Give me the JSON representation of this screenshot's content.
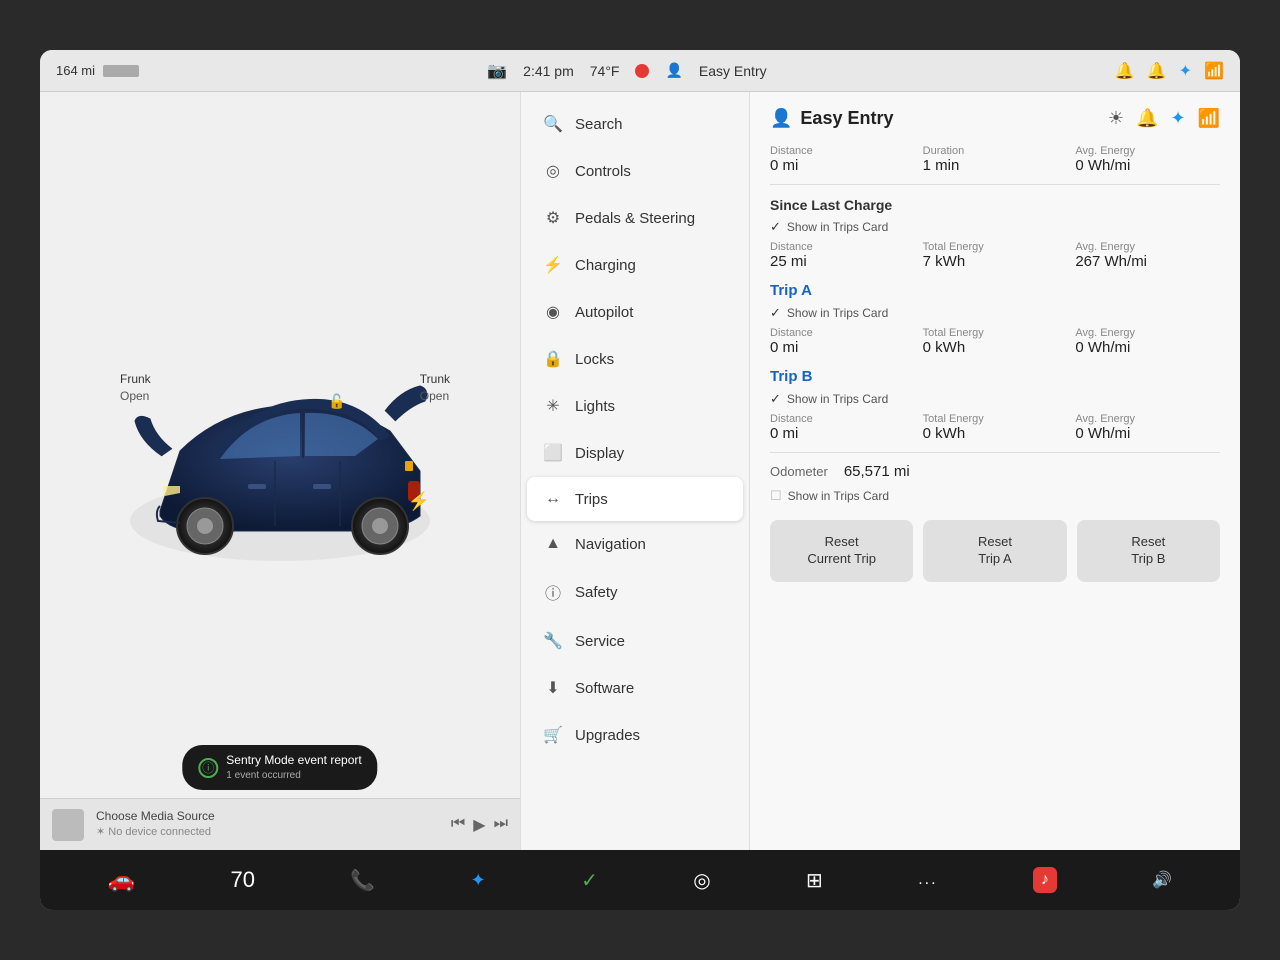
{
  "statusBar": {
    "range": "164 mi",
    "time": "2:41 pm",
    "temp": "74°F",
    "mode": "Easy Entry",
    "userIcon": "👤"
  },
  "carPanel": {
    "frunkLabel": "Frunk",
    "frunkStatus": "Open",
    "trunkLabel": "Trunk",
    "trunkStatus": "Open",
    "sentryBadge": "Sentry Mode event report",
    "sentrySubtext": "1 event occurred"
  },
  "mediaBar": {
    "chooseSource": "Choose Media Source",
    "noDevice": "✶ No device connected"
  },
  "menu": {
    "items": [
      {
        "id": "search",
        "icon": "🔍",
        "label": "Search"
      },
      {
        "id": "controls",
        "icon": "◎",
        "label": "Controls"
      },
      {
        "id": "pedals",
        "icon": "🎚",
        "label": "Pedals & Steering"
      },
      {
        "id": "charging",
        "icon": "⚡",
        "label": "Charging"
      },
      {
        "id": "autopilot",
        "icon": "◉",
        "label": "Autopilot"
      },
      {
        "id": "locks",
        "icon": "🔒",
        "label": "Locks"
      },
      {
        "id": "lights",
        "icon": "✳",
        "label": "Lights"
      },
      {
        "id": "display",
        "icon": "⬜",
        "label": "Display"
      },
      {
        "id": "trips",
        "icon": "↔",
        "label": "Trips",
        "active": true
      },
      {
        "id": "navigation",
        "icon": "▲",
        "label": "Navigation"
      },
      {
        "id": "safety",
        "icon": "ⓘ",
        "label": "Safety"
      },
      {
        "id": "service",
        "icon": "🔧",
        "label": "Service"
      },
      {
        "id": "software",
        "icon": "⬇",
        "label": "Software"
      },
      {
        "id": "upgrades",
        "icon": "🔔",
        "label": "Upgrades"
      }
    ]
  },
  "tripsPanel": {
    "title": "Easy Entry",
    "currentTrip": {
      "distance_label": "Distance",
      "distance_value": "0 mi",
      "duration_label": "Duration",
      "duration_value": "1 min",
      "avg_energy_label": "Avg. Energy",
      "avg_energy_value": "0 Wh/mi"
    },
    "sinceLastCharge": {
      "sectionTitle": "Since Last Charge",
      "showInTripsCard": "Show in Trips Card",
      "distance_label": "Distance",
      "distance_value": "25 mi",
      "total_energy_label": "Total Energy",
      "total_energy_value": "7 kWh",
      "avg_energy_label": "Avg. Energy",
      "avg_energy_value": "267 Wh/mi"
    },
    "tripA": {
      "title": "Trip A",
      "showInTripsCard": "Show in Trips Card",
      "distance_label": "Distance",
      "distance_value": "0 mi",
      "total_energy_label": "Total Energy",
      "total_energy_value": "0 kWh",
      "avg_energy_label": "Avg. Energy",
      "avg_energy_value": "0 Wh/mi"
    },
    "tripB": {
      "title": "Trip B",
      "showInTripsCard": "Show in Trips Card",
      "distance_label": "Distance",
      "distance_value": "0 mi",
      "total_energy_label": "Total Energy",
      "total_energy_value": "0 kWh",
      "avg_energy_label": "Avg. Energy",
      "avg_energy_value": "0 Wh/mi"
    },
    "odometer": {
      "label": "Odometer",
      "value": "65,571 mi",
      "showInTripsCard": "Show in Trips Card"
    },
    "resetCurrentTrip": "Reset\nCurrent Trip",
    "resetTripA": "Reset\nTrip A",
    "resetTripB": "Reset\nTrip B"
  },
  "taskbar": {
    "carIcon": "🚗",
    "volumeNumber": "70",
    "phoneIcon": "📞",
    "bluetoothIcon": "🔵",
    "checkIcon": "✓",
    "steeringIcon": "◎",
    "gridIcon": "⊞",
    "dotsLabel": "...",
    "musicIcon": "♪",
    "volumeIcon": "🔊"
  }
}
